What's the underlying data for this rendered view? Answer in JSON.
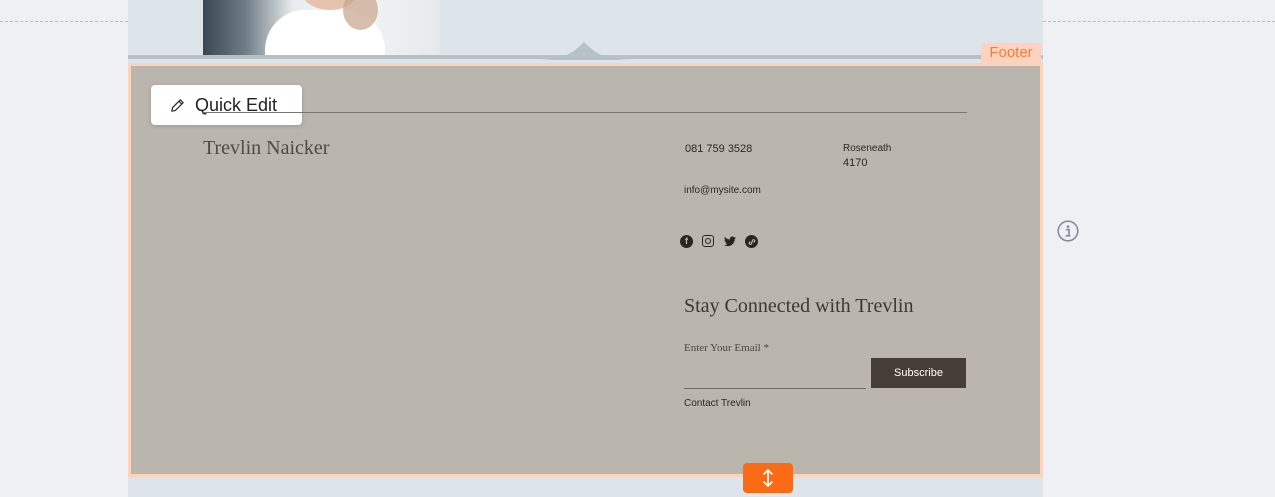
{
  "editor": {
    "quick_edit_label": "Quick Edit",
    "footer_tag": "Footer",
    "colors": {
      "accent": "#fb6a14",
      "footer_bg": "#bab6ae",
      "selection": "#fdd3bd"
    }
  },
  "footer": {
    "brand_name": "Trevlin Naicker",
    "phone": "081 759 3528",
    "address_line1": "Roseneath",
    "address_line2": "4170",
    "email": "info@mysite.com",
    "social_icons": [
      "facebook-icon",
      "instagram-icon",
      "twitter-icon",
      "link-icon"
    ],
    "newsletter": {
      "heading": "Stay Connected with Trevlin",
      "email_label": "Enter Your Email *",
      "email_value": "",
      "subscribe_label": "Subscribe"
    },
    "contact_link": "Contact Trevlin"
  }
}
